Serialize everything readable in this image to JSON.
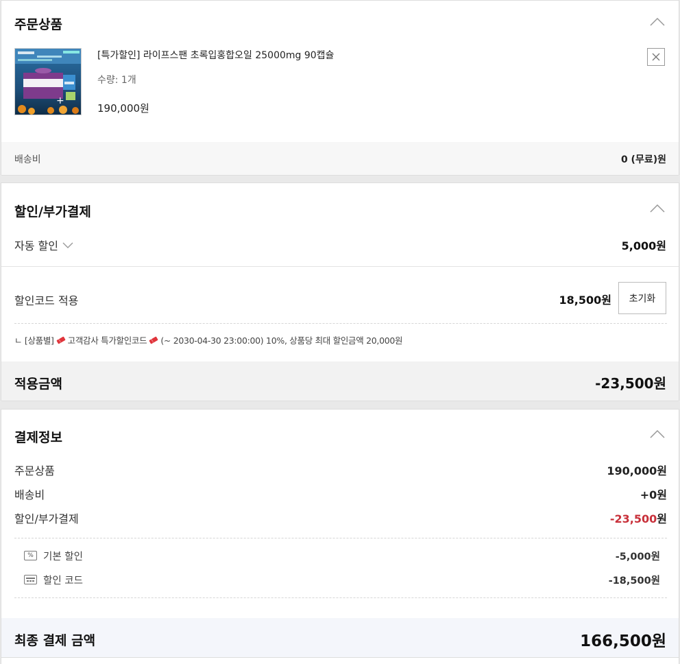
{
  "order_items": {
    "title": "주문상품",
    "product": {
      "name": "[특가할인] 라이프스팬 초록입홍합오일 25000mg 90캡슐",
      "quantity": "수량: 1개",
      "price": "190,000원"
    },
    "shipping_label": "배송비",
    "shipping_value": "0 (무료)원"
  },
  "discount": {
    "title": "할인/부가결제",
    "auto_label": "자동 할인",
    "auto_value": "5,000원",
    "code_label": "할인코드 적용",
    "code_value": "18,500원",
    "reset_button": "초기화",
    "code_detail": {
      "prefix": "ㄴ [상품별]",
      "name": "고객감사 특가할인코드",
      "period": "(~ 2030-04-30 23:00:00)  10%, 상품당 최대 할인금액 20,000원"
    },
    "applied_label": "적용금액",
    "applied_value": "-23,500원"
  },
  "payment": {
    "title": "결제정보",
    "rows": [
      {
        "label": "주문상품",
        "value": "190,000원"
      },
      {
        "label": "배송비",
        "value": "+0원"
      },
      {
        "label": "할인/부가결제",
        "value": "-23,500",
        "unit": "원"
      }
    ],
    "sub_rows": [
      {
        "label": "기본 할인",
        "value": "-5,000원",
        "icon": "percent-icon"
      },
      {
        "label": "할인 코드",
        "value": "-18,500원",
        "icon": "coupon-card-icon"
      }
    ],
    "final_label": "최종 결제 금액",
    "final_value": "166,500원"
  },
  "colors": {
    "discount_red": "#c8303a",
    "ticket_red": "#e0353c",
    "section_bg": "#f7f7f7"
  }
}
